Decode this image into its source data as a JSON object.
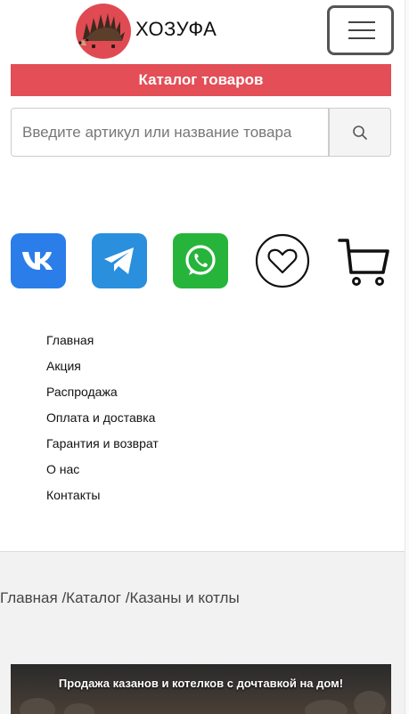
{
  "header": {
    "brand": "ХОЗУФА",
    "logo_icon": "hedgehog-logo-icon",
    "menu_icon": "hamburger-menu-icon"
  },
  "catalog_button": {
    "label": "Каталог товаров"
  },
  "search": {
    "placeholder": "Введите артикул или название товара",
    "button_icon": "search-icon"
  },
  "social": [
    {
      "name": "vk",
      "icon": "vk-icon",
      "color": "#2b7de9"
    },
    {
      "name": "telegram",
      "icon": "telegram-icon",
      "color": "#2a8fdd"
    },
    {
      "name": "whatsapp",
      "icon": "whatsapp-icon",
      "color": "#27b43b"
    },
    {
      "name": "favorites",
      "icon": "heart-icon"
    },
    {
      "name": "cart",
      "icon": "cart-icon"
    }
  ],
  "menu": {
    "items": [
      "Главная",
      "Акция",
      "Распродажа",
      "Оплата и доставка",
      "Гарантия и возврат",
      "О нас",
      "Контакты"
    ]
  },
  "breadcrumb": {
    "home": "Главная",
    "catalog": "Каталог",
    "current": "Казаны и котлы",
    "separator": " /"
  },
  "banner": {
    "text": "Продажа казанов и котелков с дочтавкой на дом!"
  },
  "colors": {
    "accent": "#e34e57",
    "logo_bg": "#e04a52"
  }
}
